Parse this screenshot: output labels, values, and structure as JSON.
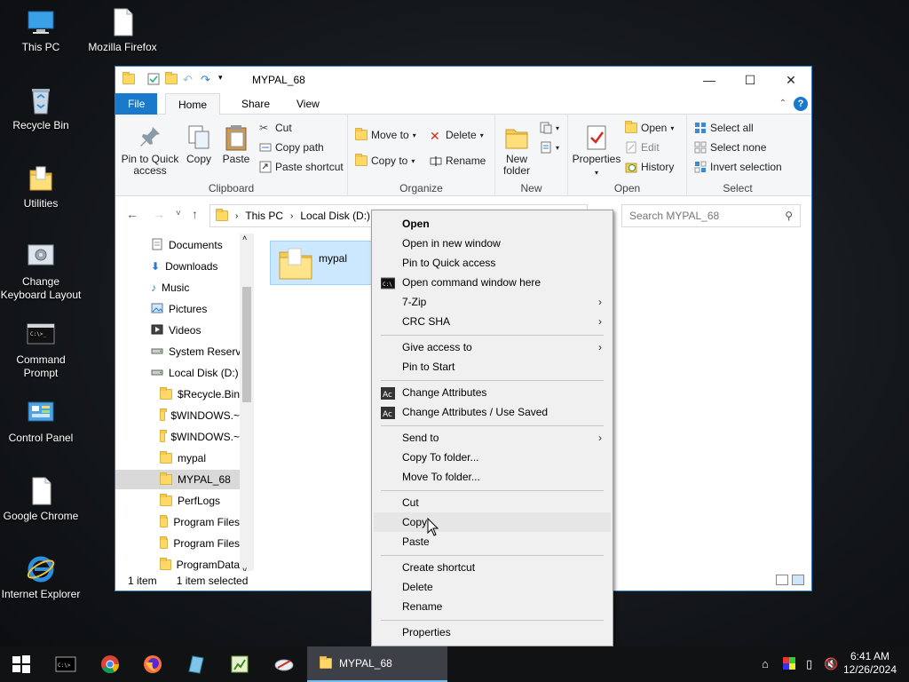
{
  "desktop": {
    "icons": [
      {
        "label": "This PC"
      },
      {
        "label": "Mozilla Firefox"
      },
      {
        "label": "Recycle Bin"
      },
      {
        "label": "Utilities"
      },
      {
        "label": "Change Keyboard Layout"
      },
      {
        "label": "Command Prompt"
      },
      {
        "label": "Control Panel"
      },
      {
        "label": "Google Chrome"
      },
      {
        "label": "Internet Explorer"
      }
    ]
  },
  "window": {
    "title": "MYPAL_68",
    "tabs": {
      "file": "File",
      "home": "Home",
      "share": "Share",
      "view": "View"
    },
    "ribbon": {
      "clipboard": {
        "label": "Clipboard",
        "pin": "Pin to Quick access",
        "copy": "Copy",
        "paste": "Paste",
        "cut": "Cut",
        "copy_path": "Copy path",
        "paste_shortcut": "Paste shortcut"
      },
      "organize": {
        "label": "Organize",
        "move_to": "Move to",
        "copy_to": "Copy to",
        "delete": "Delete",
        "rename": "Rename"
      },
      "new": {
        "label": "New",
        "new_folder": "New folder"
      },
      "open": {
        "label": "Open",
        "properties": "Properties",
        "open": "Open",
        "edit": "Edit",
        "history": "History"
      },
      "select": {
        "label": "Select",
        "select_all": "Select all",
        "select_none": "Select none",
        "invert": "Invert selection"
      }
    },
    "address": {
      "this_pc": "This PC",
      "local_disk": "Local Disk (D:)"
    },
    "search_placeholder": "Search MYPAL_68",
    "nav_items": [
      {
        "label": "Documents"
      },
      {
        "label": "Downloads"
      },
      {
        "label": "Music"
      },
      {
        "label": "Pictures"
      },
      {
        "label": "Videos"
      },
      {
        "label": "System Reserve"
      },
      {
        "label": "Local Disk (D:)"
      },
      {
        "label": "$Recycle.Bin"
      },
      {
        "label": "$WINDOWS.~"
      },
      {
        "label": "$WINDOWS.~"
      },
      {
        "label": "mypal"
      },
      {
        "label": "MYPAL_68"
      },
      {
        "label": "PerfLogs"
      },
      {
        "label": "Program Files"
      },
      {
        "label": "Program Files"
      },
      {
        "label": "ProgramData"
      }
    ],
    "file": {
      "name": "mypal"
    },
    "status": {
      "count": "1 item",
      "selected": "1 item selected"
    }
  },
  "context_menu": {
    "items": [
      {
        "label": "Open"
      },
      {
        "label": "Open in new window"
      },
      {
        "label": "Pin to Quick access"
      },
      {
        "label": "Open command window here"
      },
      {
        "label": "7-Zip"
      },
      {
        "label": "CRC SHA"
      },
      {
        "label": "Give access to"
      },
      {
        "label": "Pin to Start"
      },
      {
        "label": "Change Attributes"
      },
      {
        "label": "Change Attributes / Use Saved"
      },
      {
        "label": "Send to"
      },
      {
        "label": "Copy To folder..."
      },
      {
        "label": "Move To folder..."
      },
      {
        "label": "Cut"
      },
      {
        "label": "Copy"
      },
      {
        "label": "Paste"
      },
      {
        "label": "Create shortcut"
      },
      {
        "label": "Delete"
      },
      {
        "label": "Rename"
      },
      {
        "label": "Properties"
      }
    ]
  },
  "taskbar": {
    "window_label": "MYPAL_68",
    "time": "6:41 AM",
    "date": "12/26/2024"
  },
  "colors": {
    "accent": "#1979ca",
    "selection": "#cce8ff",
    "taskbar": "#101214"
  }
}
